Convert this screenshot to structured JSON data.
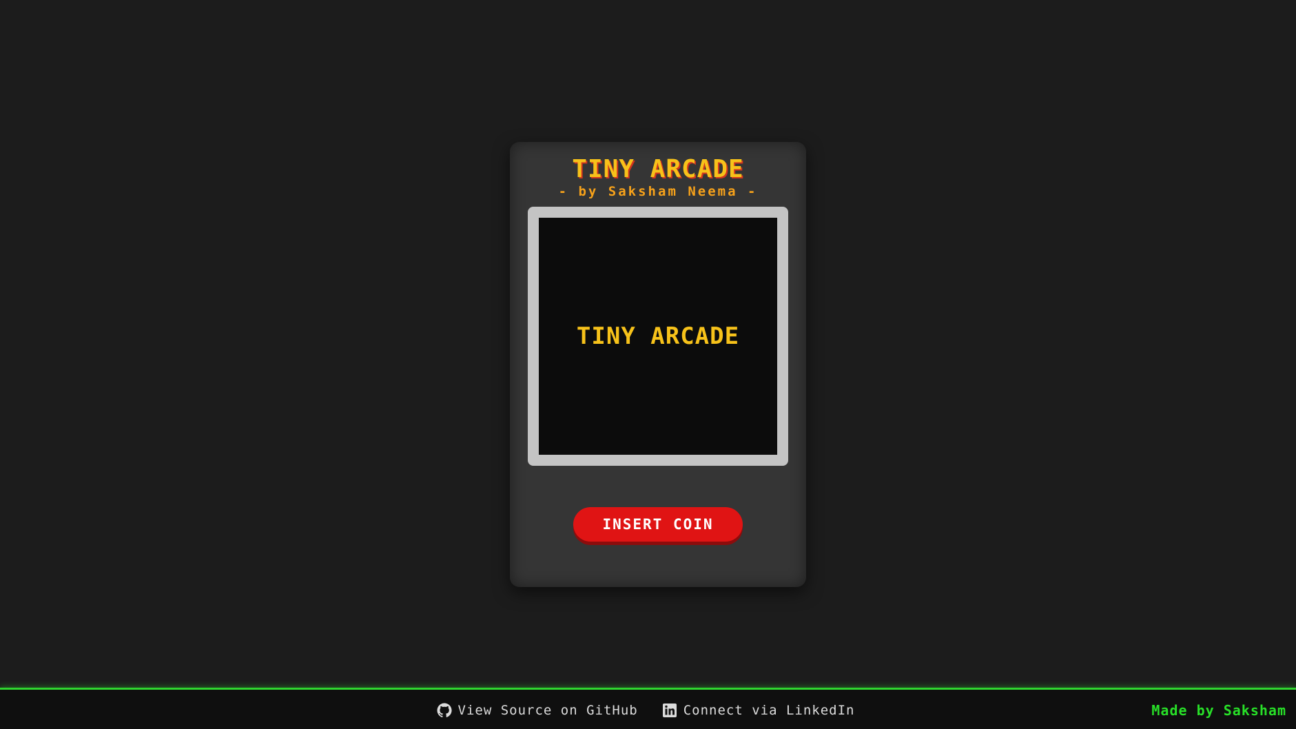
{
  "cabinet": {
    "title": "TINY ARCADE",
    "subtitle": "- by Saksham Neema -",
    "screen_text": "TINY ARCADE",
    "button_label": "INSERT COIN"
  },
  "footer": {
    "links": [
      {
        "label": "View Source on GitHub",
        "icon": "github-icon"
      },
      {
        "label": "Connect via LinkedIn",
        "icon": "linkedin-icon"
      }
    ],
    "credit": "Made by Saksham"
  },
  "colors": {
    "background": "#1c1c1c",
    "cabinet": "#353535",
    "title_yellow": "#f7c21a",
    "subtitle_orange": "#f7a21a",
    "button_red": "#e01414",
    "footer_green": "#2fd62f"
  }
}
